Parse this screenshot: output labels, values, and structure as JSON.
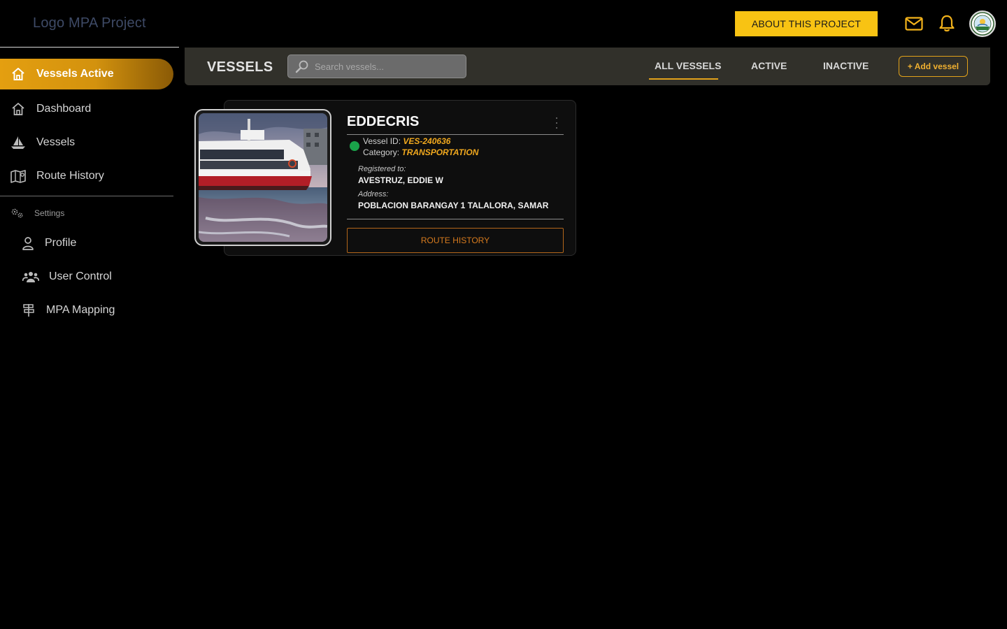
{
  "app": {
    "logo_text": "Logo MPA Project"
  },
  "topbar": {
    "about_label": "ABOUT THIS PROJECT",
    "mail_icon": "mail-icon",
    "bell_icon": "bell-icon"
  },
  "sidebar": {
    "active_label": "Vessels Active",
    "items": [
      {
        "label": "Dashboard",
        "icon": "home-icon"
      },
      {
        "label": "Vessels",
        "icon": "sailboat-icon"
      },
      {
        "label": "Route History",
        "icon": "map-icon"
      }
    ],
    "settings_label": "Settings",
    "settings_items": [
      {
        "label": "Profile",
        "icon": "user-icon"
      },
      {
        "label": "User Control",
        "icon": "users-icon"
      },
      {
        "label": "MPA Mapping",
        "icon": "signpost-icon"
      }
    ]
  },
  "header": {
    "title": "VESSELS",
    "search_placeholder": "Search vessels...",
    "tabs": [
      {
        "label": "ALL VESSELS",
        "active": true
      },
      {
        "label": "ACTIVE",
        "active": false
      },
      {
        "label": "INACTIVE",
        "active": false
      }
    ],
    "add_label": "+ Add vessel"
  },
  "vessel": {
    "name": "EDDECRIS",
    "id_label": "Vessel ID:",
    "id_value": "VES-240636",
    "category_label": "Category:",
    "category_value": "TRANSPORTATION",
    "registered_label": "Registered to:",
    "registered_value": "AVESTRUZ, EDDIE W",
    "address_label": "Address:",
    "address_value": "POBLACION BARANGAY 1 TALALORA, SAMAR",
    "status_color": "#1aa34a",
    "route_label": "ROUTE HISTORY"
  },
  "colors": {
    "accent": "#f8c313",
    "orange": "#e2a21a",
    "panel": "#31302a"
  }
}
